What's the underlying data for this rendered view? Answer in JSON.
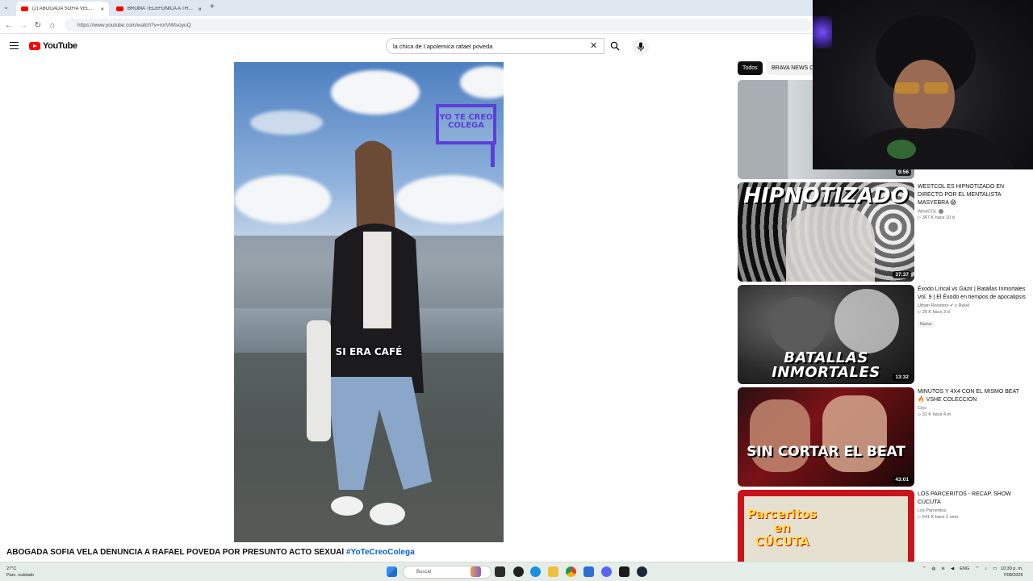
{
  "browser": {
    "tabs": [
      {
        "title": "(2) ABOGADA SOFIA VELA D",
        "active": true
      },
      {
        "title": "BROMA TELEFÓNICA A THEGR",
        "active": false
      }
    ],
    "new_tab": "+",
    "close_glyph": "×",
    "url": "https://www.youtube.com/watch?v=rorVWtsoyuQ"
  },
  "youtube": {
    "logo_text": "YouTube",
    "search_value": "la chica de l.apolemica rafael poveda",
    "clear_glyph": "✕",
    "video": {
      "badge_text": "YO TE CREO COLEGA",
      "subtitle": "SI ERA CAFÉ",
      "title": "ABOGADA SOFIA VELA DENUNCIA A RAFAEL POVEDA POR PRESUNTO ACTO SEXUAl",
      "hashtag": "#YoTeCreoColega"
    },
    "chips": [
      "Todos",
      "BRAVA NEWS CO"
    ],
    "recommended": [
      {
        "title": "",
        "channel": "",
        "meta": "",
        "duration": "9:56"
      },
      {
        "title": "WESTCOL ES HIPNOTIZADO EN DIRECTO POR EL MENTALISTA MASYEBRA 😱",
        "channel": "WestCOL",
        "meta": "▷ 367 K  hace 10 d",
        "duration": "37:37",
        "thumb_text": "HIPNOTIZADO"
      },
      {
        "title": "Éxodo Lírical vs Gazir | Batallas Inmortales Vol. 9 | El Éxodo en tiempos de apocalipsis",
        "channel": "Urban Roosters ✔ y Rykel",
        "meta": "▷ 20 K  hace 3 d",
        "badge": "Nuevo",
        "duration": "13:32",
        "thumb_text": "BATALLAS INMORTALES"
      },
      {
        "title": "MINUTOS Y 4X4 CON EL MISMO BEAT 🔥 VSHE COLECCION",
        "channel": "Cira",
        "meta": "▷ 31 K  hace 4 m",
        "duration": "43:01",
        "thumb_text": "SIN CORTAR EL BEAT"
      },
      {
        "title": "LOS PARCERITOS - RECAP. SHOW CÚCUTA",
        "channel": "Los Parceritos",
        "meta": "▷ 641 K  hace 2 sem.",
        "duration": "",
        "thumb_text": "Parceritos en CÚCUTA"
      }
    ]
  },
  "taskbar": {
    "weather_temp": "27°C",
    "weather_desc": "Parc. nublado",
    "search_placeholder": "Buscar",
    "lang": "ENG",
    "time": "10:30 p. m.",
    "date": "7/08/2026"
  },
  "colors": {
    "youtube_red": "#ff0000",
    "badge_purple": "#5b3fd8",
    "link_blue": "#065fd4"
  }
}
